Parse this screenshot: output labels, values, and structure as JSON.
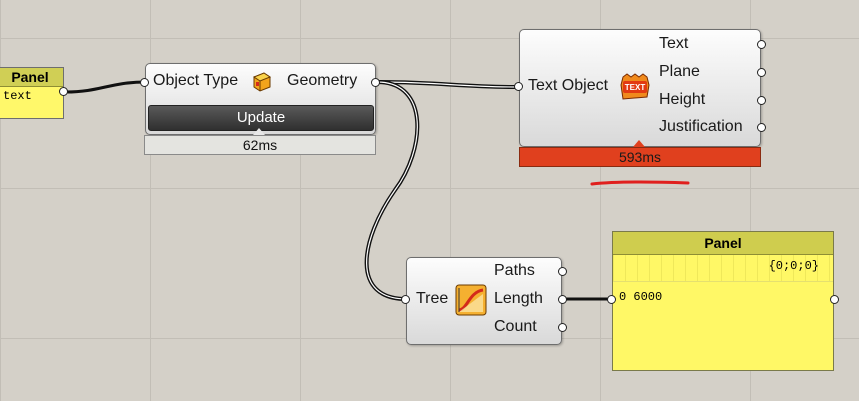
{
  "panel_left": {
    "title": "Panel",
    "content": "text"
  },
  "object_type_component": {
    "input_label": "Object Type",
    "output_label": "Geometry",
    "update_button": "Update",
    "timer": "62ms"
  },
  "text_object_component": {
    "input_label": "Text Object",
    "icon_text": "TEXT",
    "outputs": [
      "Text",
      "Plane",
      "Height",
      "Justification"
    ],
    "timer": "593ms",
    "timer_color": "#e0401e"
  },
  "tree_component": {
    "input_label": "Tree",
    "outputs": [
      "Paths",
      "Length",
      "Count"
    ]
  },
  "panel_right": {
    "title": "Panel",
    "path": "{0;0;0}",
    "index": "0",
    "value": "6000"
  },
  "colors": {
    "panel_yellow": "#fff866",
    "canvas": "#d4d0c8",
    "annotation": "#e0201e"
  }
}
